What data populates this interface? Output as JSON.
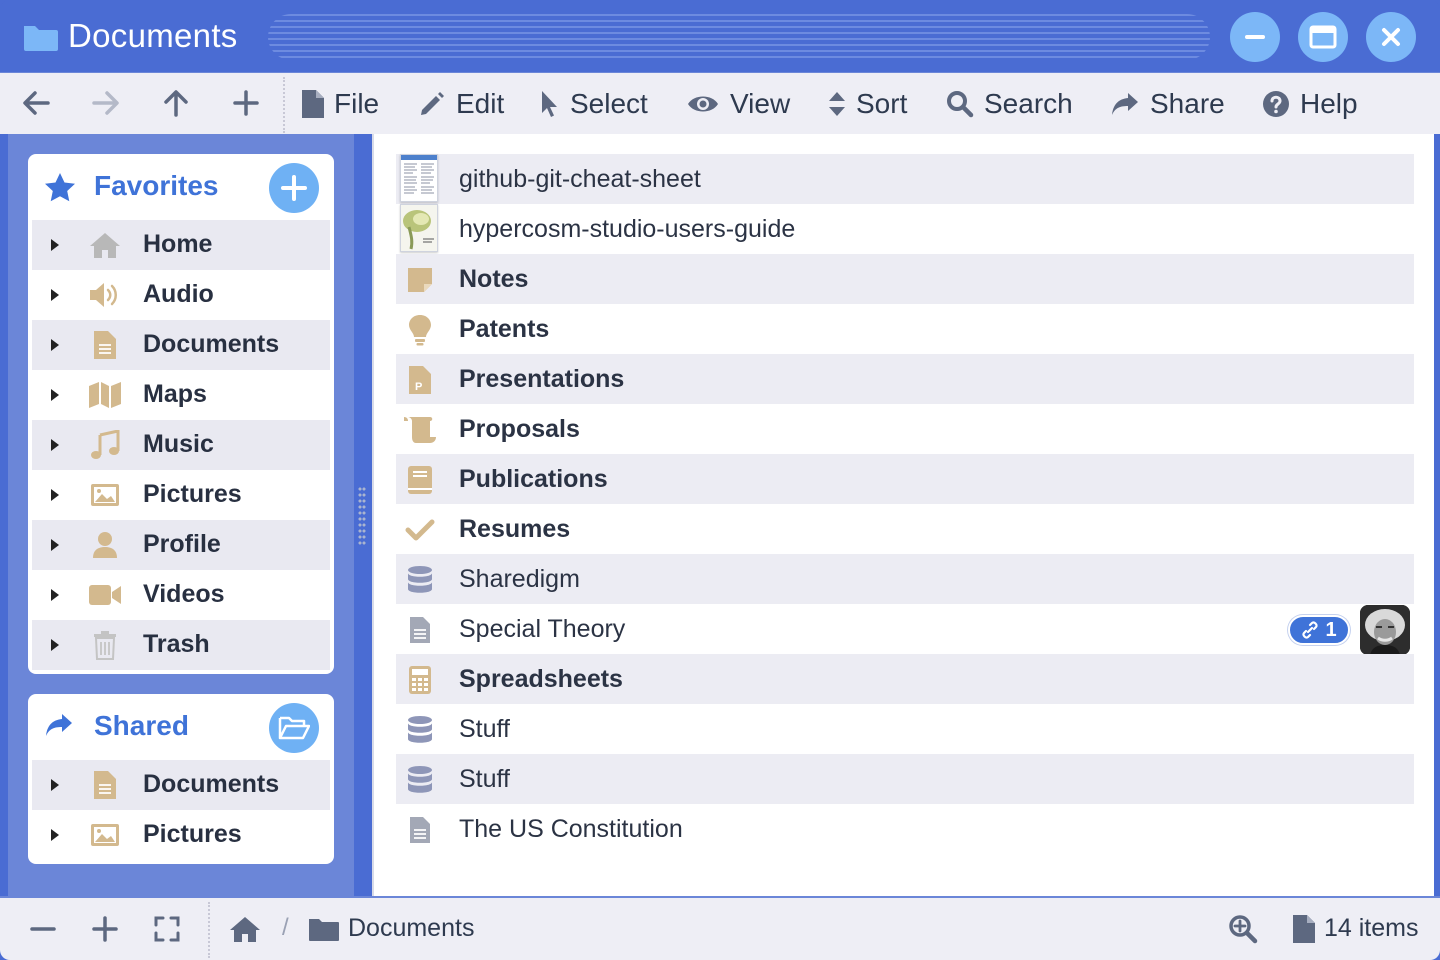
{
  "window": {
    "title": "Documents",
    "buttons": [
      "minimize",
      "maximize",
      "close"
    ]
  },
  "toolbar": {
    "nav": [
      "back-arrow",
      "forward-arrow",
      "up-arrow",
      "new-plus"
    ],
    "menus": [
      {
        "label": "File",
        "icon": "file-icon"
      },
      {
        "label": "Edit",
        "icon": "pencil-icon"
      },
      {
        "label": "Select",
        "icon": "cursor-icon"
      },
      {
        "label": "View",
        "icon": "eye-icon"
      },
      {
        "label": "Sort",
        "icon": "sort-icon"
      },
      {
        "label": "Search",
        "icon": "search-icon"
      },
      {
        "label": "Share",
        "icon": "share-icon"
      },
      {
        "label": "Help",
        "icon": "help-icon"
      }
    ]
  },
  "sidebar": {
    "favorites": {
      "title": "Favorites",
      "items": [
        {
          "label": "Home",
          "icon": "home-icon"
        },
        {
          "label": "Audio",
          "icon": "speaker-icon"
        },
        {
          "label": "Documents",
          "icon": "document-icon"
        },
        {
          "label": "Maps",
          "icon": "map-icon"
        },
        {
          "label": "Music",
          "icon": "music-icon"
        },
        {
          "label": "Pictures",
          "icon": "picture-icon"
        },
        {
          "label": "Profile",
          "icon": "user-icon"
        },
        {
          "label": "Videos",
          "icon": "video-icon"
        },
        {
          "label": "Trash",
          "icon": "trash-icon"
        }
      ]
    },
    "shared": {
      "title": "Shared",
      "items": [
        {
          "label": "Documents",
          "icon": "document-icon"
        },
        {
          "label": "Pictures",
          "icon": "picture-icon"
        }
      ]
    }
  },
  "files": [
    {
      "label": "github-git-cheat-sheet",
      "icon": "thumbnail-sheet",
      "bold": false
    },
    {
      "label": "hypercosm-studio-users-guide",
      "icon": "thumbnail-guide",
      "bold": false
    },
    {
      "label": "Notes",
      "icon": "note-icon",
      "bold": true
    },
    {
      "label": "Patents",
      "icon": "lightbulb-icon",
      "bold": true
    },
    {
      "label": "Presentations",
      "icon": "presentation-icon",
      "bold": true
    },
    {
      "label": "Proposals",
      "icon": "scroll-icon",
      "bold": true
    },
    {
      "label": "Publications",
      "icon": "book-icon",
      "bold": true
    },
    {
      "label": "Resumes",
      "icon": "check-icon",
      "bold": true
    },
    {
      "label": "Sharedigm",
      "icon": "database-icon",
      "bold": false
    },
    {
      "label": "Special Theory",
      "icon": "text-file-icon",
      "bold": false,
      "share_count": "1"
    },
    {
      "label": "Spreadsheets",
      "icon": "calculator-icon",
      "bold": true
    },
    {
      "label": "Stuff",
      "icon": "database-icon",
      "bold": false
    },
    {
      "label": "Stuff",
      "icon": "database-icon",
      "bold": false
    },
    {
      "label": "The US Constitution",
      "icon": "text-file-icon",
      "bold": false
    }
  ],
  "statusbar": {
    "breadcrumb_separator": "/",
    "breadcrumb_current": "Documents",
    "item_count": "14 items"
  },
  "colors": {
    "accent": "#4a6cd3",
    "panel_accent": "#6b86d8",
    "link_blue": "#3f73d8",
    "folder_tan": "#d3b98e",
    "db_blue": "#8e96b8"
  }
}
